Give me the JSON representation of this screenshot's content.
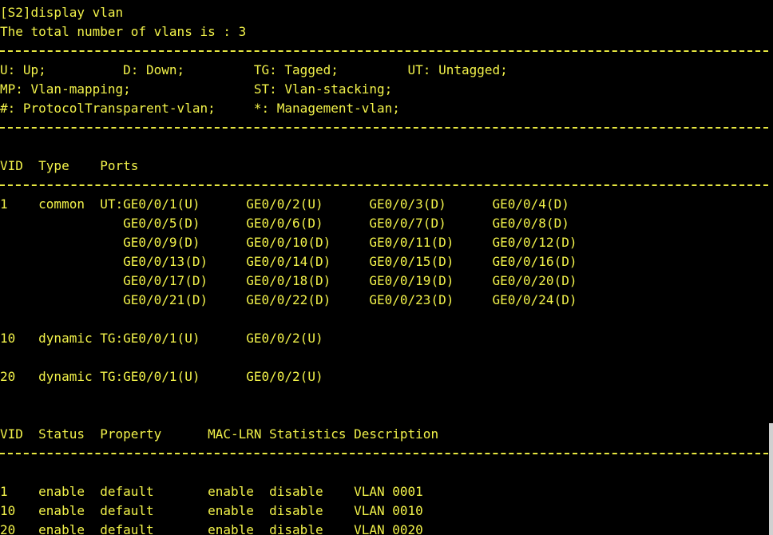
{
  "terminal": {
    "lines": [
      "[S2]display vlan",
      "The total number of vlans is : 3",
      "U: Up;          D: Down;         TG: Tagged;         UT: Untagged;",
      "MP: Vlan-mapping;                ST: Vlan-stacking;",
      "#: ProtocolTransparent-vlan;     *: Management-vlan;",
      "VID  Type    Ports",
      "1    common  UT:GE0/0/1(U)      GE0/0/2(U)      GE0/0/3(D)      GE0/0/4(D)",
      "                GE0/0/5(D)      GE0/0/6(D)      GE0/0/7(D)      GE0/0/8(D)",
      "                GE0/0/9(D)      GE0/0/10(D)     GE0/0/11(D)     GE0/0/12(D)",
      "                GE0/0/13(D)     GE0/0/14(D)     GE0/0/15(D)     GE0/0/16(D)",
      "                GE0/0/17(D)     GE0/0/18(D)     GE0/0/19(D)     GE0/0/20(D)",
      "                GE0/0/21(D)     GE0/0/22(D)     GE0/0/23(D)     GE0/0/24(D)",
      "10   dynamic TG:GE0/0/1(U)      GE0/0/2(U)",
      "20   dynamic TG:GE0/0/1(U)      GE0/0/2(U)",
      "VID  Status  Property      MAC-LRN Statistics Description",
      "1    enable  default       enable  disable    VLAN 0001",
      "10   enable  default       enable  disable    VLAN 0010",
      "20   enable  default       enable  disable    VLAN 0020"
    ]
  },
  "colors": {
    "background": "#000000",
    "text": "#f2f24a",
    "separator": "#e6e640"
  }
}
